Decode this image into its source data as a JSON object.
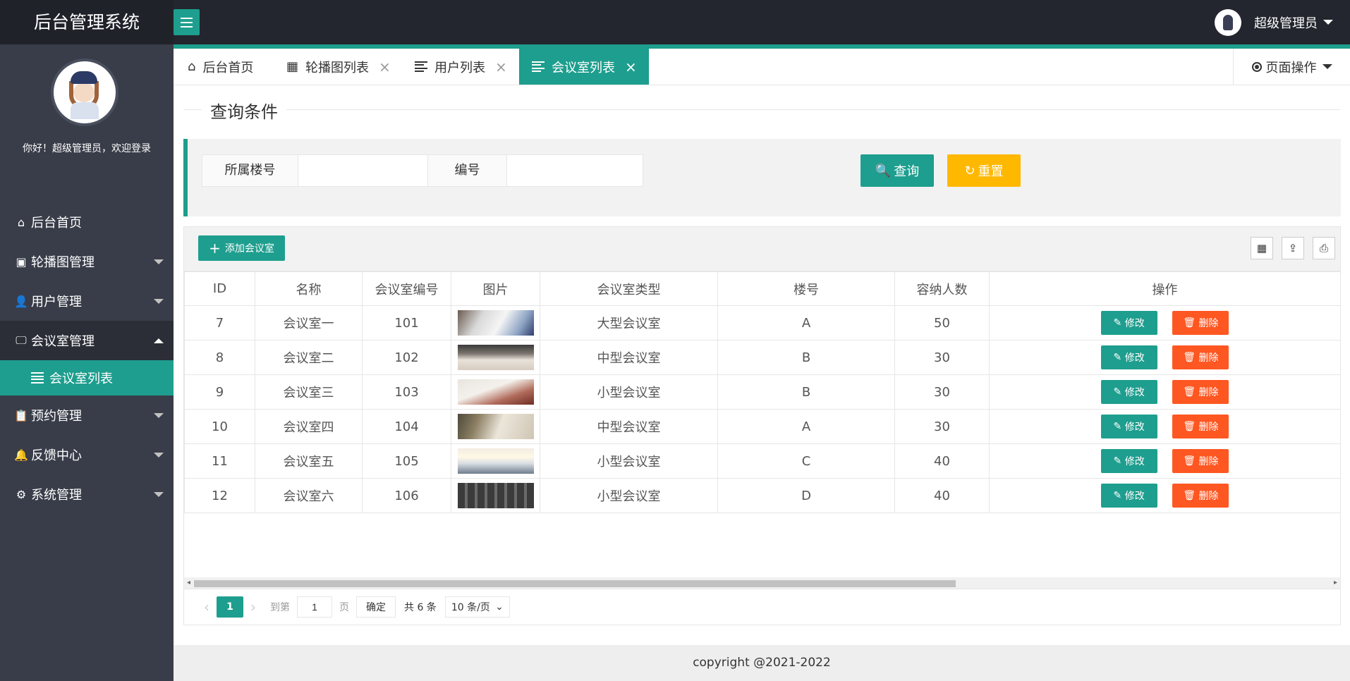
{
  "app": {
    "title": "后台管理系统"
  },
  "header": {
    "user_name": "超级管理员"
  },
  "sidebar": {
    "welcome": "你好！超级管理员，欢迎登录",
    "items": [
      {
        "label": "后台首页",
        "icon": "home-icon"
      },
      {
        "label": "轮播图管理",
        "icon": "image-icon"
      },
      {
        "label": "用户管理",
        "icon": "user-icon"
      },
      {
        "label": "会议室管理",
        "icon": "monitor-icon"
      },
      {
        "label": "预约管理",
        "icon": "clipboard-icon"
      },
      {
        "label": "反馈中心",
        "icon": "bell-icon"
      },
      {
        "label": "系统管理",
        "icon": "gear-icon"
      }
    ],
    "sub_item": "会议室列表"
  },
  "tabs": [
    {
      "label": "后台首页"
    },
    {
      "label": "轮播图列表"
    },
    {
      "label": "用户列表"
    },
    {
      "label": "会议室列表"
    }
  ],
  "page_ops": "页面操作",
  "query": {
    "title": "查询条件",
    "field1_label": "所属楼号",
    "field1_value": "",
    "field2_label": "编号",
    "field2_value": "",
    "search_label": "查询",
    "reset_label": "重置"
  },
  "table": {
    "add_label": "添加会议室",
    "headers": [
      "ID",
      "名称",
      "会议室编号",
      "图片",
      "会议室类型",
      "楼号",
      "容纳人数",
      "操作"
    ],
    "rows": [
      {
        "id": "7",
        "name": "会议室一",
        "code": "101",
        "type": "大型会议室",
        "building": "A",
        "capacity": "50"
      },
      {
        "id": "8",
        "name": "会议室二",
        "code": "102",
        "type": "中型会议室",
        "building": "B",
        "capacity": "30"
      },
      {
        "id": "9",
        "name": "会议室三",
        "code": "103",
        "type": "小型会议室",
        "building": "B",
        "capacity": "30"
      },
      {
        "id": "10",
        "name": "会议室四",
        "code": "104",
        "type": "中型会议室",
        "building": "A",
        "capacity": "30"
      },
      {
        "id": "11",
        "name": "会议室五",
        "code": "105",
        "type": "小型会议室",
        "building": "C",
        "capacity": "40"
      },
      {
        "id": "12",
        "name": "会议室六",
        "code": "106",
        "type": "小型会议室",
        "building": "D",
        "capacity": "40"
      }
    ],
    "edit_label": "修改",
    "delete_label": "删除"
  },
  "pager": {
    "current": "1",
    "goto_prefix": "到第",
    "goto_value": "1",
    "goto_suffix": "页",
    "confirm_label": "确定",
    "total": "共 6 条",
    "page_size": "10 条/页"
  },
  "footer": {
    "copyright": "copyright @2021-2022"
  },
  "colors": {
    "primary": "#1e9e8e",
    "warning": "#ffb800",
    "danger": "#ff5722",
    "sidebar": "#393d49",
    "header": "#23262e"
  }
}
